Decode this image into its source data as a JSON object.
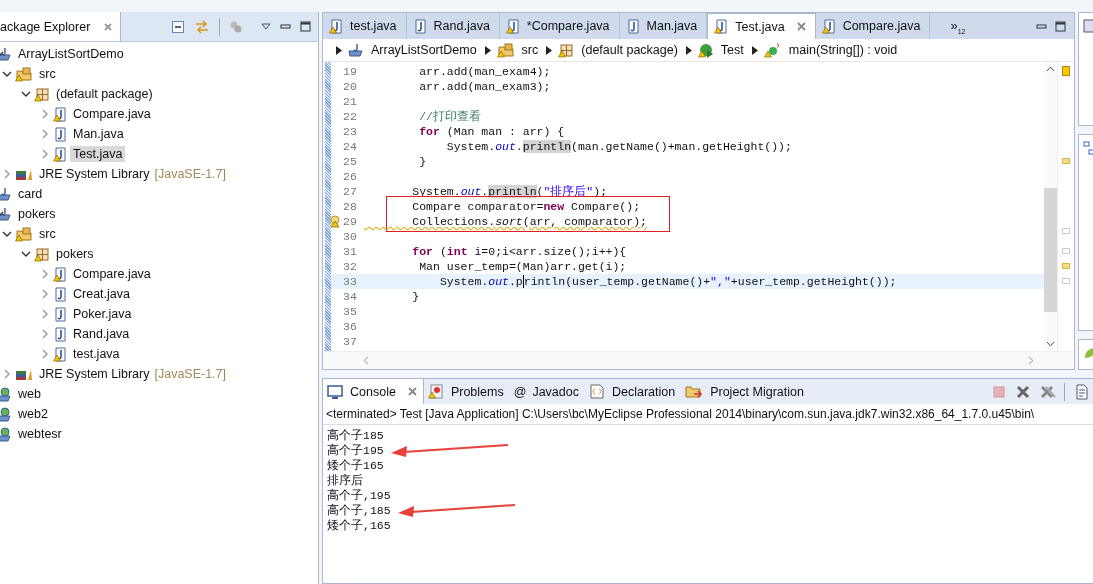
{
  "explorer": {
    "title": "ackage Explorer",
    "tree": [
      {
        "label": "ArrayListSortDemo",
        "kind": "project",
        "warning": false,
        "expanded": true,
        "selected": false,
        "children": [
          {
            "label": "src",
            "kind": "folder",
            "warning": true,
            "expanded": true,
            "selected": false,
            "children": [
              {
                "label": "(default package)",
                "kind": "package",
                "warning": true,
                "expanded": true,
                "selected": false,
                "children": [
                  {
                    "label": "Compare.java",
                    "kind": "file",
                    "warning": true,
                    "expanded": false,
                    "selected": false
                  },
                  {
                    "label": "Man.java",
                    "kind": "file",
                    "warning": false,
                    "expanded": false,
                    "selected": false
                  },
                  {
                    "label": "Test.java",
                    "kind": "file",
                    "warning": true,
                    "expanded": false,
                    "selected": true
                  }
                ]
              }
            ]
          },
          {
            "label": "JRE System Library",
            "suffix": "[JavaSE-1.7]",
            "kind": "library",
            "warning": false,
            "expanded": false,
            "selected": false
          }
        ]
      },
      {
        "label": "card",
        "kind": "project",
        "warning": false,
        "selected": false
      },
      {
        "label": "pokers",
        "kind": "project",
        "warning": false,
        "expanded": true,
        "selected": false,
        "children": [
          {
            "label": "src",
            "kind": "folder",
            "warning": true,
            "expanded": true,
            "selected": false,
            "children": [
              {
                "label": "pokers",
                "kind": "package",
                "warning": true,
                "expanded": true,
                "selected": false,
                "children": [
                  {
                    "label": "Compare.java",
                    "kind": "file",
                    "warning": true,
                    "expanded": false,
                    "selected": false
                  },
                  {
                    "label": "Creat.java",
                    "kind": "file",
                    "warning": false,
                    "expanded": false,
                    "selected": false
                  },
                  {
                    "label": "Poker.java",
                    "kind": "file",
                    "warning": false,
                    "expanded": false,
                    "selected": false
                  },
                  {
                    "label": "Rand.java",
                    "kind": "file",
                    "warning": false,
                    "expanded": false,
                    "selected": false
                  },
                  {
                    "label": "test.java",
                    "kind": "file",
                    "warning": true,
                    "expanded": false,
                    "selected": false
                  }
                ]
              }
            ]
          },
          {
            "label": "JRE System Library",
            "suffix": "[JavaSE-1.7]",
            "kind": "library",
            "warning": false,
            "expanded": false,
            "selected": false
          }
        ]
      },
      {
        "label": "web",
        "kind": "web",
        "warning": false,
        "selected": false
      },
      {
        "label": "web2",
        "kind": "web",
        "warning": false,
        "selected": false
      },
      {
        "label": "webtesr",
        "kind": "web",
        "warning": false,
        "selected": false
      }
    ]
  },
  "editor": {
    "tabs": [
      {
        "label": "test.java",
        "warning": true,
        "selected": false
      },
      {
        "label": "Rand.java",
        "warning": false,
        "selected": false
      },
      {
        "label": "*Compare.java",
        "warning": true,
        "selected": false
      },
      {
        "label": "Man.java",
        "warning": false,
        "selected": false
      },
      {
        "label": "Test.java",
        "warning": true,
        "selected": true
      },
      {
        "label": "Compare.java",
        "warning": true,
        "selected": false
      }
    ],
    "overflow": "»",
    "overflow_count": "12",
    "breadcrumb": [
      {
        "label": "ArrayListSortDemo",
        "kind": "project",
        "warning": false
      },
      {
        "label": "src",
        "kind": "folder",
        "warning": true
      },
      {
        "label": "(default package)",
        "kind": "package",
        "warning": true
      },
      {
        "label": "Test",
        "kind": "class",
        "warning": true
      },
      {
        "label": "main(String[]) : void",
        "kind": "method",
        "warning": true
      }
    ],
    "lines": [
      {
        "number": "19",
        "current": false,
        "boxed": false,
        "warn": false,
        "tokens": [
          {
            "kind": "plain",
            "text": "        arr.add(man_exam4);"
          }
        ]
      },
      {
        "number": "20",
        "current": false,
        "boxed": false,
        "warn": false,
        "tokens": [
          {
            "kind": "plain",
            "text": "        arr.add(man_exam3);"
          }
        ]
      },
      {
        "number": "21",
        "current": false,
        "boxed": false,
        "warn": false
      },
      {
        "number": "22",
        "current": false,
        "boxed": false,
        "warn": false,
        "tokens": [
          {
            "kind": "comment",
            "text": "        //打印查看"
          }
        ]
      },
      {
        "number": "23",
        "current": false,
        "boxed": false,
        "warn": false,
        "tokens": [
          {
            "kind": "keyword",
            "text": "        for"
          },
          {
            "kind": "plain",
            "text": " (Man man : arr) {"
          }
        ]
      },
      {
        "number": "24",
        "current": false,
        "boxed": false,
        "warn": false,
        "tokens": [
          {
            "kind": "plain",
            "text": "            System."
          },
          {
            "kind": "field",
            "text": "out"
          },
          {
            "kind": "plain",
            "text": "."
          },
          {
            "kind": "mark",
            "text": "println"
          },
          {
            "kind": "plain",
            "text": "(man.getName()+man.getHeight());"
          }
        ]
      },
      {
        "number": "25",
        "current": false,
        "boxed": false,
        "warn": false,
        "tokens": [
          {
            "kind": "plain",
            "text": "        }"
          }
        ]
      },
      {
        "number": "26",
        "current": false,
        "boxed": false,
        "warn": false
      },
      {
        "number": "27",
        "current": false,
        "boxed": false,
        "warn": false,
        "tokens": [
          {
            "kind": "plain",
            "text": "       System."
          },
          {
            "kind": "field",
            "text": "out"
          },
          {
            "kind": "plain",
            "text": "."
          },
          {
            "kind": "mark",
            "text": "println"
          },
          {
            "kind": "plain",
            "text": "("
          },
          {
            "kind": "string",
            "text": "\"排序后\""
          },
          {
            "kind": "plain",
            "text": ");"
          }
        ]
      },
      {
        "number": "28",
        "current": false,
        "boxed": true,
        "warn": false,
        "tokens": [
          {
            "kind": "plain",
            "text": "       Compare comparator="
          },
          {
            "kind": "keyword",
            "text": "new"
          },
          {
            "kind": "plain",
            "text": " Compare();"
          }
        ]
      },
      {
        "number": "29",
        "current": false,
        "boxed": true,
        "warn": true,
        "tokens": [
          {
            "kind": "plain",
            "text": "       Collections."
          },
          {
            "kind": "static",
            "text": "sort"
          },
          {
            "kind": "plain",
            "text": "(arr, comparator);"
          }
        ]
      },
      {
        "number": "30",
        "current": false,
        "boxed": false,
        "warn": false
      },
      {
        "number": "31",
        "current": false,
        "boxed": false,
        "warn": false,
        "tokens": [
          {
            "kind": "keyword",
            "text": "       for"
          },
          {
            "kind": "plain",
            "text": " ("
          },
          {
            "kind": "keyword",
            "text": "int"
          },
          {
            "kind": "plain",
            "text": " i=0;i<arr.size();i++){"
          }
        ]
      },
      {
        "number": "32",
        "current": false,
        "boxed": false,
        "warn": false,
        "tokens": [
          {
            "kind": "plain",
            "text": "        Man user_temp=(Man)arr.get(i);"
          }
        ]
      },
      {
        "number": "33",
        "current": true,
        "boxed": false,
        "warn": false,
        "tokens": [
          {
            "kind": "plain",
            "text": "           System."
          },
          {
            "kind": "field",
            "text": "out"
          },
          {
            "kind": "plain",
            "text": ".p",
            "caret": true
          },
          {
            "kind": "plain",
            "text": "rintln(user_temp.getName()+"
          },
          {
            "kind": "string",
            "text": "\",\""
          },
          {
            "kind": "plain",
            "text": "+user_temp.getHeight());"
          }
        ]
      },
      {
        "number": "34",
        "current": false,
        "boxed": false,
        "warn": false,
        "tokens": [
          {
            "kind": "plain",
            "text": "       }"
          }
        ]
      },
      {
        "number": "35",
        "current": false,
        "boxed": false,
        "warn": false
      },
      {
        "number": "36",
        "current": false,
        "boxed": false,
        "warn": false
      },
      {
        "number": "37",
        "current": false,
        "boxed": false,
        "warn": false
      }
    ]
  },
  "console": {
    "tabs": [
      {
        "label": "Console",
        "kind": "console",
        "selected": true
      },
      {
        "label": "Problems",
        "kind": "problems",
        "selected": false
      },
      {
        "label": "Javadoc",
        "kind": "symbol",
        "symbol": "@",
        "selected": false
      },
      {
        "label": "Declaration",
        "kind": "declaration",
        "selected": false
      },
      {
        "label": "Project Migration",
        "kind": "migration",
        "selected": false
      }
    ],
    "status": "<terminated> Test [Java Application] C:\\Users\\bc\\MyEclipse Professional 2014\\binary\\com.sun.java.jdk7.win32.x86_64_1.7.0.u45\\bin\\",
    "output": [
      {
        "text": "高个子185",
        "arrow": false
      },
      {
        "text": "高个子195",
        "arrow": true
      },
      {
        "text": "矮个子165",
        "arrow": false
      },
      {
        "text": "排序后",
        "arrow": false
      },
      {
        "text": "高个子,195",
        "arrow": false
      },
      {
        "text": "高个子,185",
        "arrow": true
      },
      {
        "text": "矮个子,165",
        "arrow": false
      }
    ]
  }
}
